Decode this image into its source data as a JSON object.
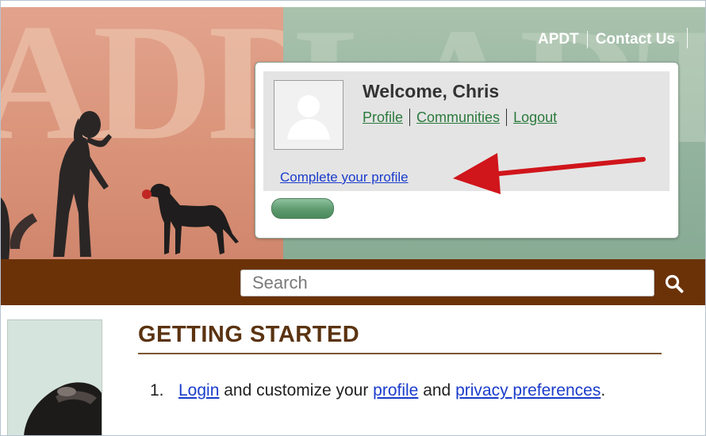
{
  "header": {
    "links": [
      {
        "label": "APDT"
      },
      {
        "label": "Contact Us"
      }
    ]
  },
  "welcome": {
    "title": "Welcome, Chris",
    "links": [
      {
        "label": "Profile"
      },
      {
        "label": "Communities"
      },
      {
        "label": "Logout"
      }
    ],
    "complete_profile_label": "Complete your profile",
    "progress": 0.19
  },
  "search": {
    "placeholder": "Search"
  },
  "main": {
    "section_title": "GETTING STARTED",
    "steps": [
      {
        "number": "1.",
        "parts": [
          {
            "text": "Login",
            "link": true
          },
          {
            "text": " and customize your ",
            "link": false
          },
          {
            "text": "profile",
            "link": true
          },
          {
            "text": " and ",
            "link": false
          },
          {
            "text": "privacy preferences",
            "link": true
          },
          {
            "text": ".",
            "link": false
          }
        ]
      }
    ]
  },
  "colors": {
    "search_bar": "#6b3208",
    "section_title": "#5b3311",
    "link_blue": "#1a3ccc",
    "link_green": "#2b7a3d",
    "arrow": "#d0151b",
    "progress": "#5d9a6e"
  },
  "icons": {
    "search": "search-icon",
    "avatar": "user-silhouette-icon",
    "arrow": "red-arrow-icon"
  }
}
